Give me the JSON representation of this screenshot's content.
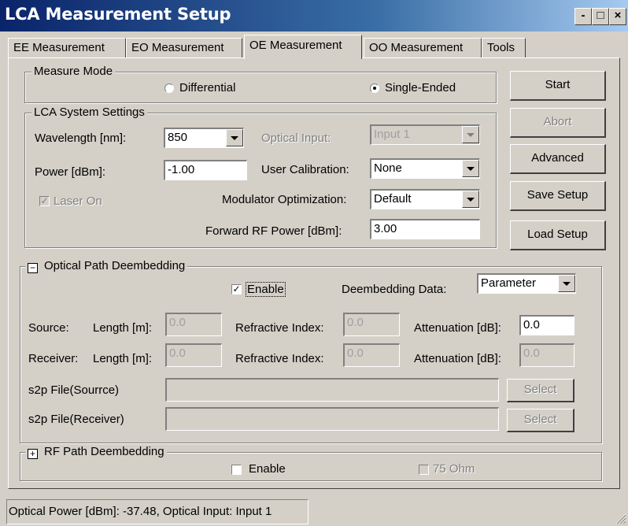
{
  "window": {
    "title": "LCA Measurement Setup",
    "controls": {
      "minimize": "-",
      "maximize": "□",
      "close": "×"
    }
  },
  "tabs": [
    {
      "label": "EE Measurement",
      "active": false
    },
    {
      "label": "EO Measurement",
      "active": false
    },
    {
      "label": "OE Measurement",
      "active": true
    },
    {
      "label": "OO Measurement",
      "active": false
    },
    {
      "label": "Tools",
      "active": false
    }
  ],
  "measure_mode": {
    "legend": "Measure Mode",
    "options": [
      {
        "label": "Differential",
        "selected": false
      },
      {
        "label": "Single-Ended",
        "selected": true
      }
    ]
  },
  "lca_system": {
    "legend": "LCA System Settings",
    "wavelength_label": "Wavelength [nm]:",
    "wavelength_value": "850",
    "power_label": "Power [dBm]:",
    "power_value": "-1.00",
    "laser_on_label": "Laser On",
    "laser_on_checked": true,
    "optical_input_label": "Optical Input:",
    "optical_input_value": "Input 1",
    "user_calibration_label": "User Calibration:",
    "user_calibration_value": "None",
    "modulator_opt_label": "Modulator Optimization:",
    "modulator_opt_value": "Default",
    "forward_rf_label": "Forward RF Power [dBm]:",
    "forward_rf_value": "3.00"
  },
  "buttons": {
    "start": "Start",
    "abort": "Abort",
    "advanced": "Advanced",
    "save_setup": "Save Setup",
    "load_setup": "Load Setup"
  },
  "optical_path": {
    "expander": "−",
    "legend": "Optical Path Deembedding",
    "enable_label": "Enable",
    "enable_checked": true,
    "deembed_data_label": "Deembedding Data:",
    "deembed_data_value": "Parameter",
    "source_label": "Source:",
    "receiver_label": "Receiver:",
    "length_label": "Length [m]:",
    "refractive_label": "Refractive Index:",
    "attenuation_label": "Attenuation [dB]:",
    "source_length": "0.0",
    "source_refractive": "0.0",
    "source_attenuation": "0.0",
    "receiver_length": "0.0",
    "receiver_refractive": "0.0",
    "receiver_attenuation": "0.0",
    "s2p_source_label": "s2p File(Sourrce)",
    "s2p_receiver_label": "s2p File(Receiver)",
    "s2p_source_value": "",
    "s2p_receiver_value": "",
    "select_label": "Select"
  },
  "rf_path": {
    "expander": "+",
    "legend": "RF Path Deembedding",
    "enable_label": "Enable",
    "enable_checked": false,
    "ohm_label": "75 Ohm",
    "ohm_checked": false
  },
  "status": {
    "text": "Optical Power [dBm]: -37.48,  Optical Input: Input 1"
  }
}
